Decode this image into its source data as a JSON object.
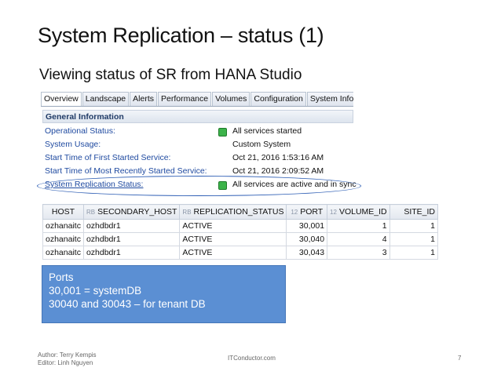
{
  "slide": {
    "title": "System Replication – status (1)",
    "subtitle": "Viewing status of SR from HANA Studio"
  },
  "tabs": [
    "Overview",
    "Landscape",
    "Alerts",
    "Performance",
    "Volumes",
    "Configuration",
    "System Information"
  ],
  "active_tab": "Overview",
  "general_info": {
    "header": "General Information",
    "rows": [
      {
        "label": "Operational Status:",
        "value": "All services started",
        "status_icon": true
      },
      {
        "label": "System Usage:",
        "value": "Custom System",
        "status_icon": false
      },
      {
        "label": "Start Time of First Started Service:",
        "value": "Oct 21, 2016 1:53:16 AM",
        "status_icon": false
      },
      {
        "label": "Start Time of Most Recently Started Service:",
        "value": "Oct 21, 2016 2:09:52 AM",
        "status_icon": false
      },
      {
        "label": "System Replication Status:",
        "value": "All services are active and in sync",
        "status_icon": true
      }
    ],
    "status_color": "#3cb34a"
  },
  "table": {
    "columns": [
      {
        "type": "",
        "name": "HOST"
      },
      {
        "type": "RB",
        "name": "SECONDARY_HOST"
      },
      {
        "type": "RB",
        "name": "REPLICATION_STATUS"
      },
      {
        "type": "12",
        "name": "PORT"
      },
      {
        "type": "12",
        "name": "VOLUME_ID"
      },
      {
        "type": "",
        "name": "SITE_ID"
      }
    ],
    "rows": [
      [
        "ozhanaitc",
        "ozhdbdr1",
        "ACTIVE",
        "30,001",
        "1",
        "1"
      ],
      [
        "ozhanaitc",
        "ozhdbdr1",
        "ACTIVE",
        "30,040",
        "4",
        "1"
      ],
      [
        "ozhanaitc",
        "ozhdbdr1",
        "ACTIVE",
        "30,043",
        "3",
        "1"
      ]
    ]
  },
  "callout": {
    "lines": [
      "Ports",
      "30,001 = systemDB",
      "30040 and 30043 – for tenant DB"
    ],
    "color": "#5b8fd3"
  },
  "footer": {
    "author": "Author: Terry Kempis",
    "editor": "Editor: Linh Nguyen",
    "site": "ITConductor.com",
    "page": "7"
  },
  "highlight_color": "#2f5fb5"
}
